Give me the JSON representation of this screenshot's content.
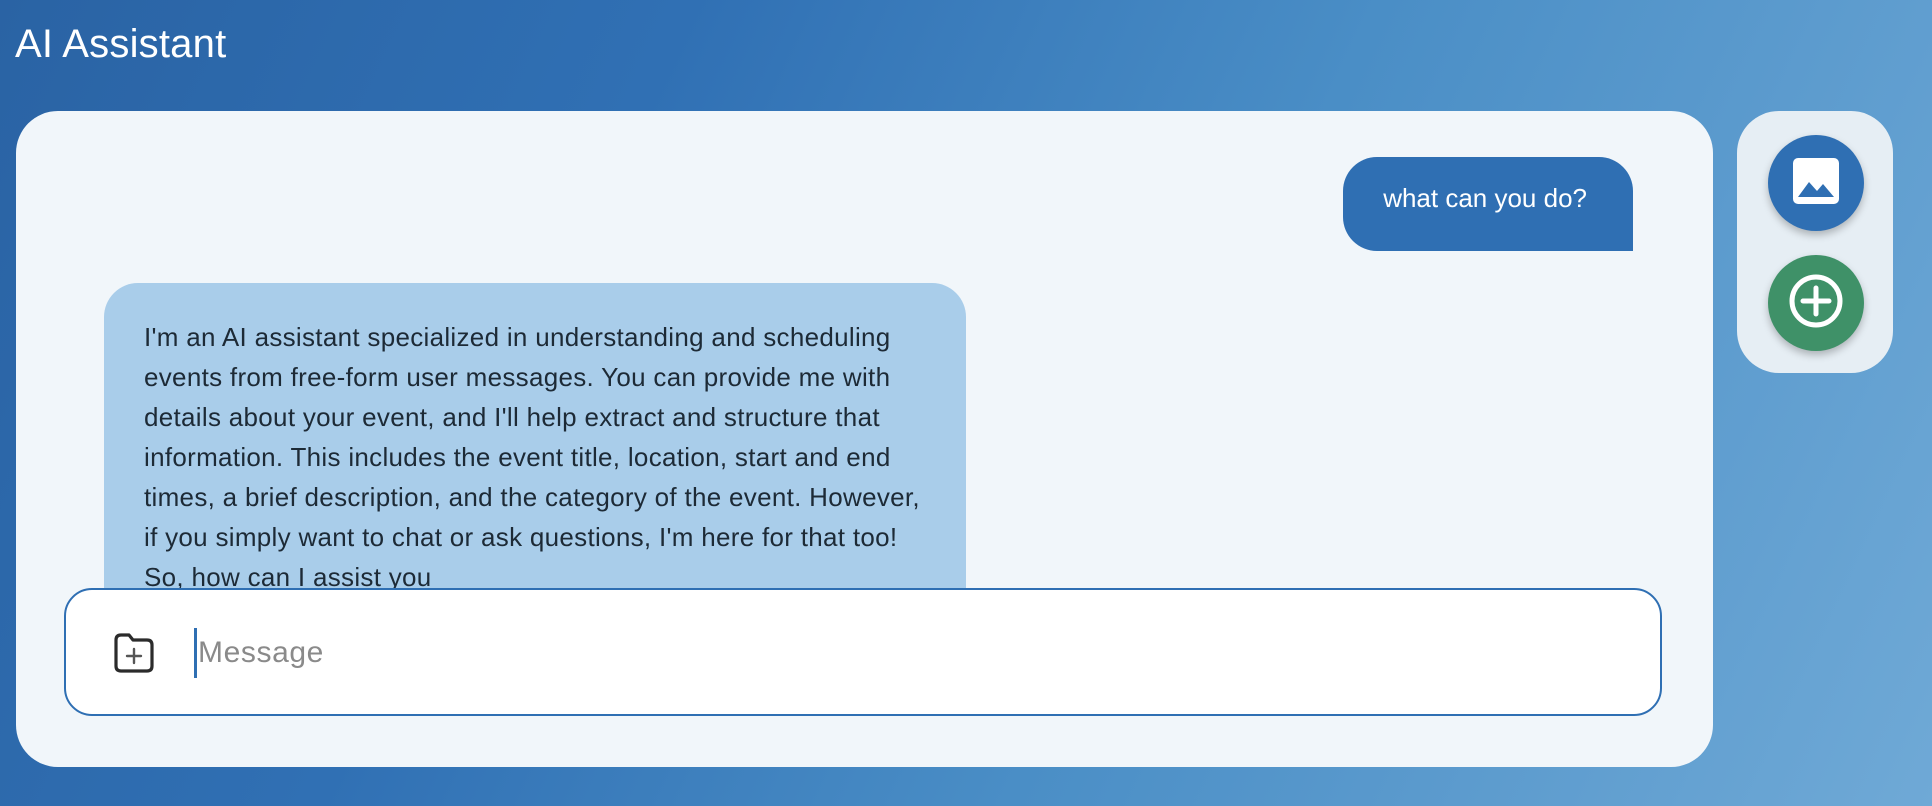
{
  "app": {
    "title": "AI Assistant"
  },
  "conversation": {
    "messages": [
      {
        "role": "user",
        "text": "what can you do?"
      },
      {
        "role": "assistant",
        "text": "I'm an AI assistant specialized in understanding and scheduling events from free-form user messages. You can provide me with details about your event, and I'll help extract and structure that information. This includes the event title, location, start and end times, a brief description, and the category of the event. However, if you simply want to chat or ask questions, I'm here for that too! So, how can I assist you"
      }
    ]
  },
  "composer": {
    "placeholder": "Message",
    "value": "",
    "attach_icon": "folder-add-icon"
  },
  "side_actions": {
    "image_icon": "image-icon",
    "add_icon": "plus-circle-icon"
  },
  "colors": {
    "user_bubble": "#2f6fb3",
    "assistant_bubble": "#a9cdea",
    "add_button": "#3f9168",
    "panel_bg": "#f1f6fa"
  }
}
